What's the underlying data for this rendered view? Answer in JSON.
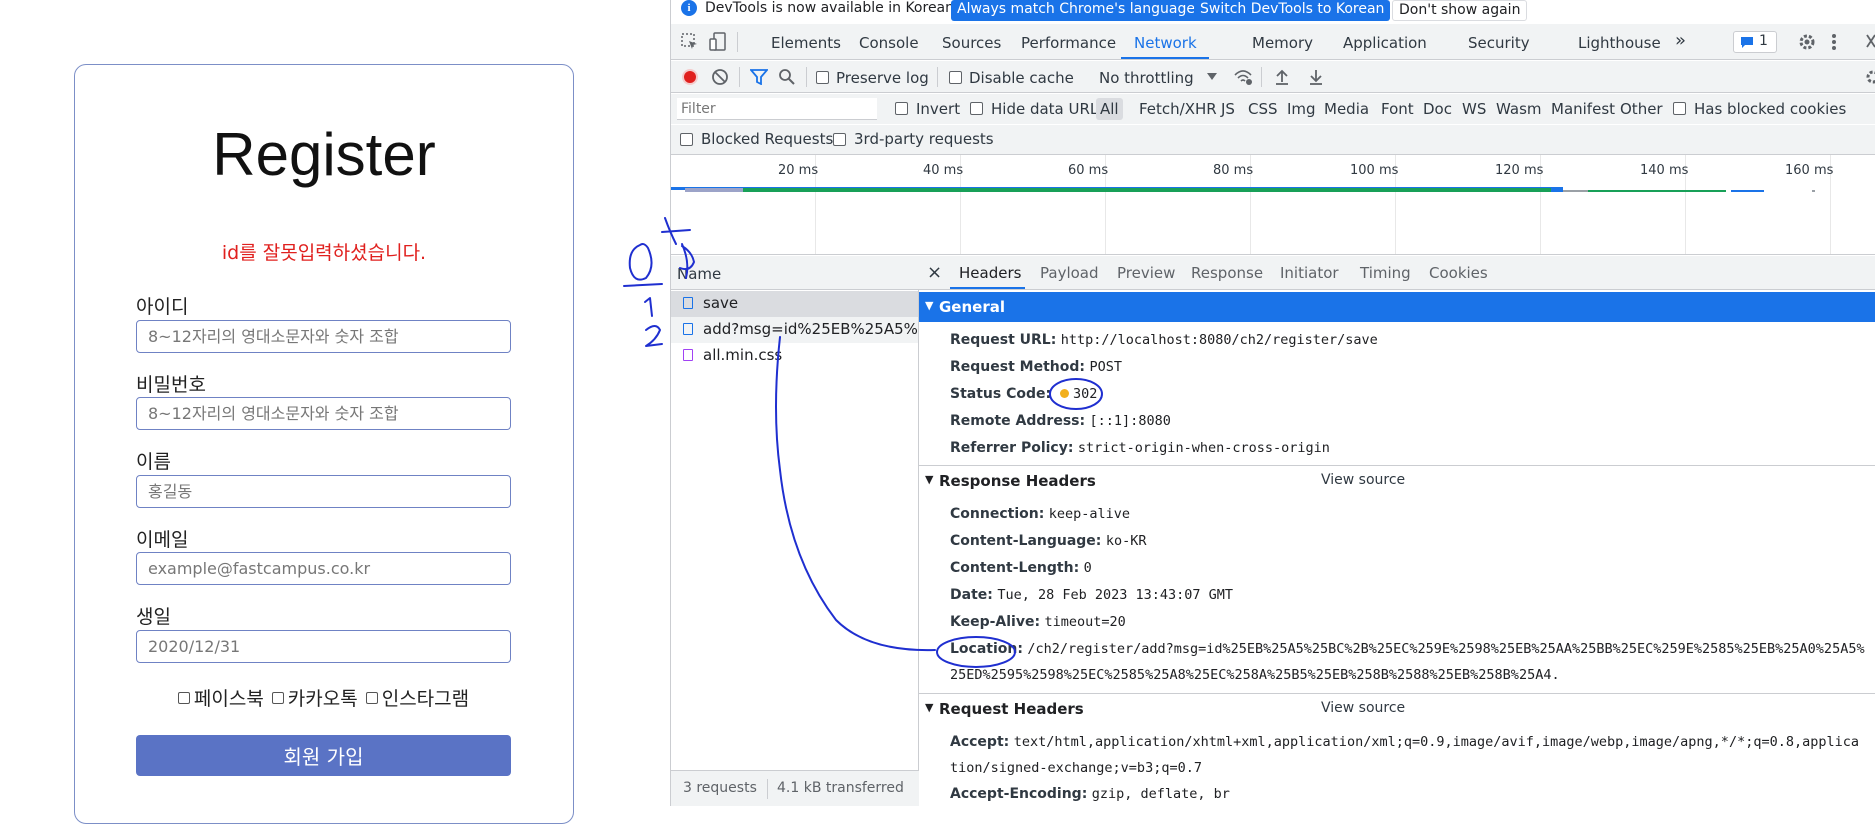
{
  "form": {
    "title": "Register",
    "error_message": "id를 잘못입력하셨습니다.",
    "fields": [
      {
        "label": "아이디",
        "placeholder": "8~12자리의 영대소문자와 숫자 조합",
        "value": ""
      },
      {
        "label": "비밀번호",
        "placeholder": "8~12자리의 영대소문자와 숫자 조합",
        "value": ""
      },
      {
        "label": "이름",
        "placeholder": "홍길동",
        "value": ""
      },
      {
        "label": "이메일",
        "placeholder": "example@fastcampus.co.kr",
        "value": ""
      },
      {
        "label": "생일",
        "placeholder": "2020/12/31",
        "value": ""
      }
    ],
    "sns": [
      "페이스북",
      "카카오톡",
      "인스타그램"
    ],
    "submit_label": "회원 가입"
  },
  "devtools": {
    "infobar": {
      "icon": "i",
      "text": "DevTools is now available in Korean!",
      "btn_match": "Always match Chrome's language",
      "btn_switch": "Switch DevTools to Korean",
      "btn_dismiss": "Don't show again"
    },
    "panel_tabs": [
      "Elements",
      "Console",
      "Sources",
      "Performance",
      "Network",
      "Memory",
      "Application",
      "Security",
      "Lighthouse"
    ],
    "more_tabs_glyph": "»",
    "issues_count": "1",
    "toolbar": {
      "preserve_log": "Preserve log",
      "disable_cache": "Disable cache",
      "throttling": "No throttling"
    },
    "filter": {
      "placeholder": "Filter",
      "invert": "Invert",
      "hide_data_urls": "Hide data URLs",
      "types": [
        "All",
        "Fetch/XHR",
        "JS",
        "CSS",
        "Img",
        "Media",
        "Font",
        "Doc",
        "WS",
        "Wasm",
        "Manifest",
        "Other"
      ],
      "has_blocked_cookies": "Has blocked cookies",
      "blocked_requests": "Blocked Requests",
      "third_party": "3rd-party requests"
    },
    "timeline_ticks": [
      "20 ms",
      "40 ms",
      "60 ms",
      "80 ms",
      "100 ms",
      "120 ms",
      "140 ms",
      "160 ms"
    ],
    "requests_header": "Name",
    "requests": [
      {
        "name": "save",
        "type": "doc"
      },
      {
        "name": "add?msg=id%25EB%25A5%2...",
        "type": "doc"
      },
      {
        "name": "all.min.css",
        "type": "css"
      }
    ],
    "status_bar": {
      "requests": "3 requests",
      "transferred": "4.1 kB transferred"
    },
    "detail_tabs": [
      "Headers",
      "Payload",
      "Preview",
      "Response",
      "Initiator",
      "Timing",
      "Cookies"
    ],
    "close_glyph": "×",
    "general": {
      "title": "General",
      "rows": [
        {
          "key": "Request URL:",
          "value": "http://localhost:8080/ch2/register/save"
        },
        {
          "key": "Request Method:",
          "value": "POST"
        },
        {
          "key": "Status Code:",
          "value": "302"
        },
        {
          "key": "Remote Address:",
          "value": "[::1]:8080"
        },
        {
          "key": "Referrer Policy:",
          "value": "strict-origin-when-cross-origin"
        }
      ]
    },
    "response_headers": {
      "title": "Response Headers",
      "view_source": "View source",
      "rows": [
        {
          "key": "Connection:",
          "value": "keep-alive"
        },
        {
          "key": "Content-Language:",
          "value": "ko-KR"
        },
        {
          "key": "Content-Length:",
          "value": "0"
        },
        {
          "key": "Date:",
          "value": "Tue, 28 Feb 2023 13:43:07 GMT"
        },
        {
          "key": "Keep-Alive:",
          "value": "timeout=20"
        },
        {
          "key": "Location:",
          "value": "/ch2/register/add?msg=id%25EB%25A5%25BC%2B%25EC%259E%2598%25EB%25AA%25BB%25EC%259E%2585%25EB%25A0%25A5%"
        },
        {
          "key": "",
          "value": "25ED%2595%2598%25EC%2585%25A8%25EC%258A%25B5%25EB%258B%2588%25EB%258B%25A4."
        }
      ]
    },
    "request_headers": {
      "title": "Request Headers",
      "view_source": "View source",
      "rows": [
        {
          "key": "Accept:",
          "value": "text/html,application/xhtml+xml,application/xml;q=0.9,image/avif,image/webp,image/apng,*/*;q=0.8,applica"
        },
        {
          "key": "",
          "value": "tion/signed-exchange;v=b3;q=0.7"
        },
        {
          "key": "Accept-Encoding:",
          "value": "gzip, deflate, br"
        }
      ]
    }
  },
  "colors": {
    "accent": "#1a73e8",
    "error": "#e0201e",
    "submit": "#5a73c5",
    "annotation_ink": "#1f2fd0"
  }
}
